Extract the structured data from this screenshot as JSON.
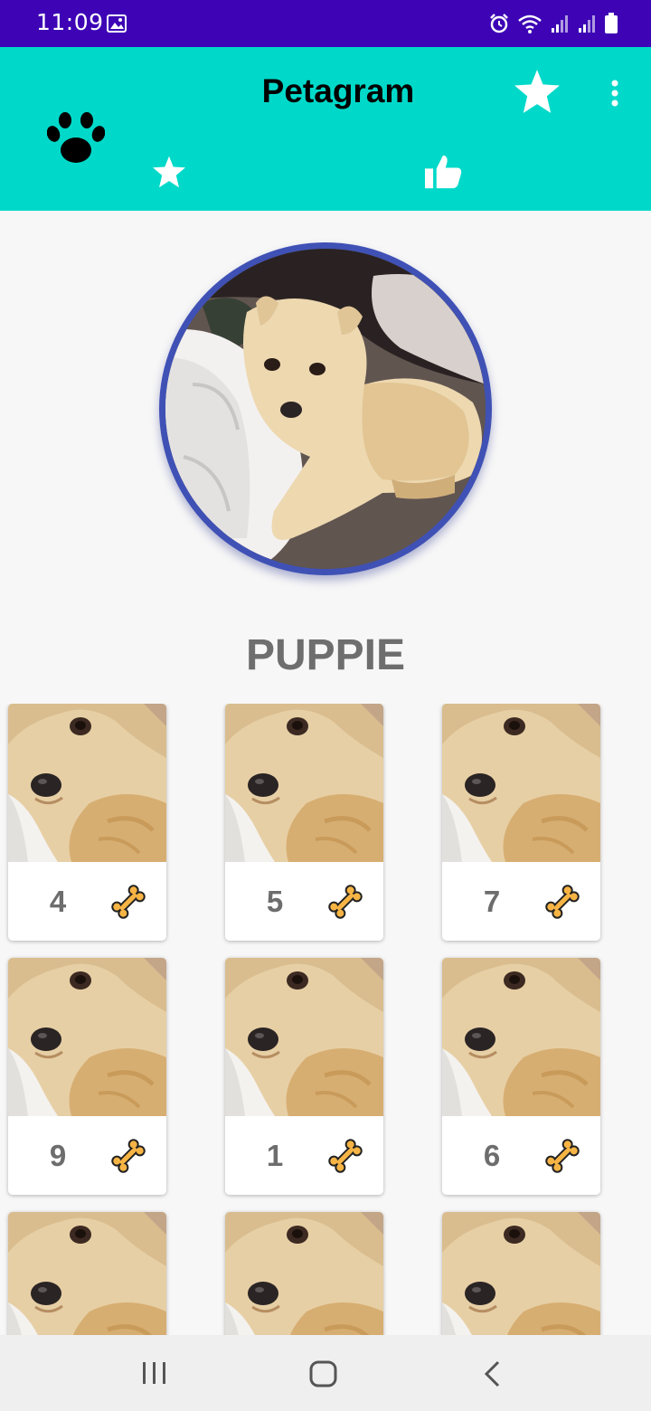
{
  "status_bar": {
    "time": "11:09",
    "icons": [
      "gallery-icon",
      "alarm-icon",
      "wifi-icon",
      "signal-icon",
      "signal-icon",
      "battery-icon"
    ]
  },
  "app_bar": {
    "title": "Petagram",
    "logo_icon": "paw-icon",
    "actions": [
      "star-icon",
      "more-vert-icon"
    ],
    "tabs": [
      {
        "icon": "star-icon",
        "selected": true
      },
      {
        "icon": "thumbs-up-icon",
        "selected": false
      }
    ]
  },
  "profile": {
    "name": "PUPPIE"
  },
  "grid": {
    "cards": [
      {
        "count": "4"
      },
      {
        "count": "5"
      },
      {
        "count": "7"
      },
      {
        "count": "9"
      },
      {
        "count": "1"
      },
      {
        "count": "6"
      },
      {
        "count": ""
      },
      {
        "count": ""
      },
      {
        "count": ""
      }
    ],
    "like_icon": "bone-icon"
  },
  "colors": {
    "status_bar": "#3d03b5",
    "app_bar": "#00d9c9",
    "avatar_ring": "#3f51b5",
    "bone": "#f6b445",
    "count_text": "#6d6d6d"
  },
  "nav_bar": {
    "buttons": [
      "recents-icon",
      "home-icon",
      "back-icon"
    ]
  }
}
